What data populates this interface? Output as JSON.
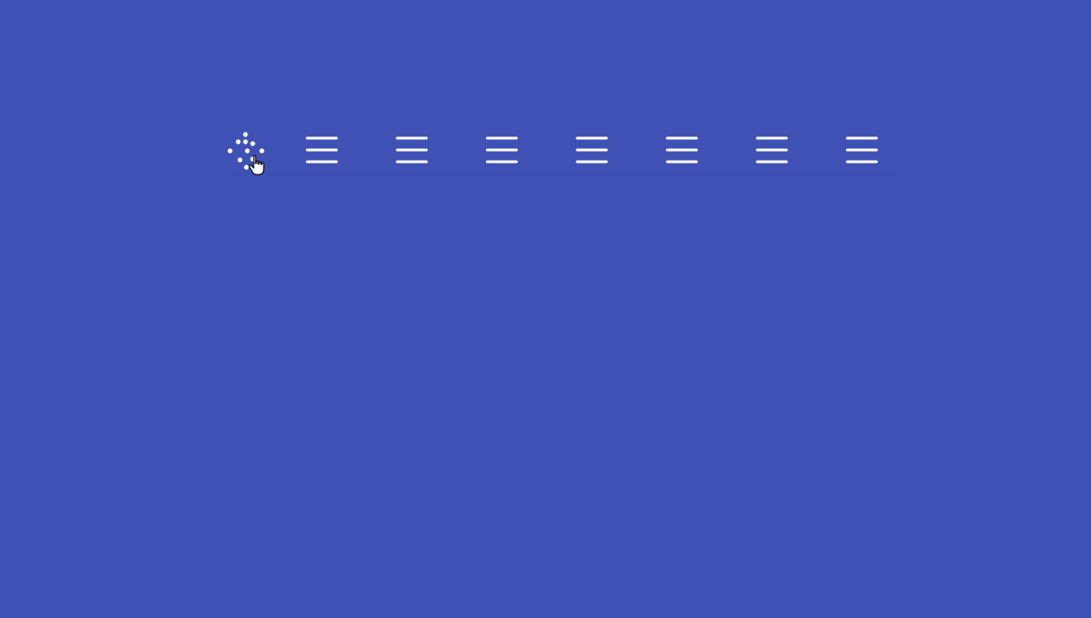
{
  "colors": {
    "background": "#3f51b5",
    "icon": "#ffffff"
  },
  "toolbar": {
    "active_icon": "scatter-dots-icon",
    "icons": [
      {
        "name": "dotted-diamond-icon"
      },
      {
        "name": "hamburger-menu-icon"
      },
      {
        "name": "hamburger-menu-icon"
      },
      {
        "name": "hamburger-menu-icon"
      },
      {
        "name": "hamburger-menu-icon"
      },
      {
        "name": "hamburger-menu-icon"
      },
      {
        "name": "hamburger-menu-icon"
      },
      {
        "name": "hamburger-menu-icon"
      }
    ]
  },
  "cursor": {
    "type": "pointer-hand"
  }
}
